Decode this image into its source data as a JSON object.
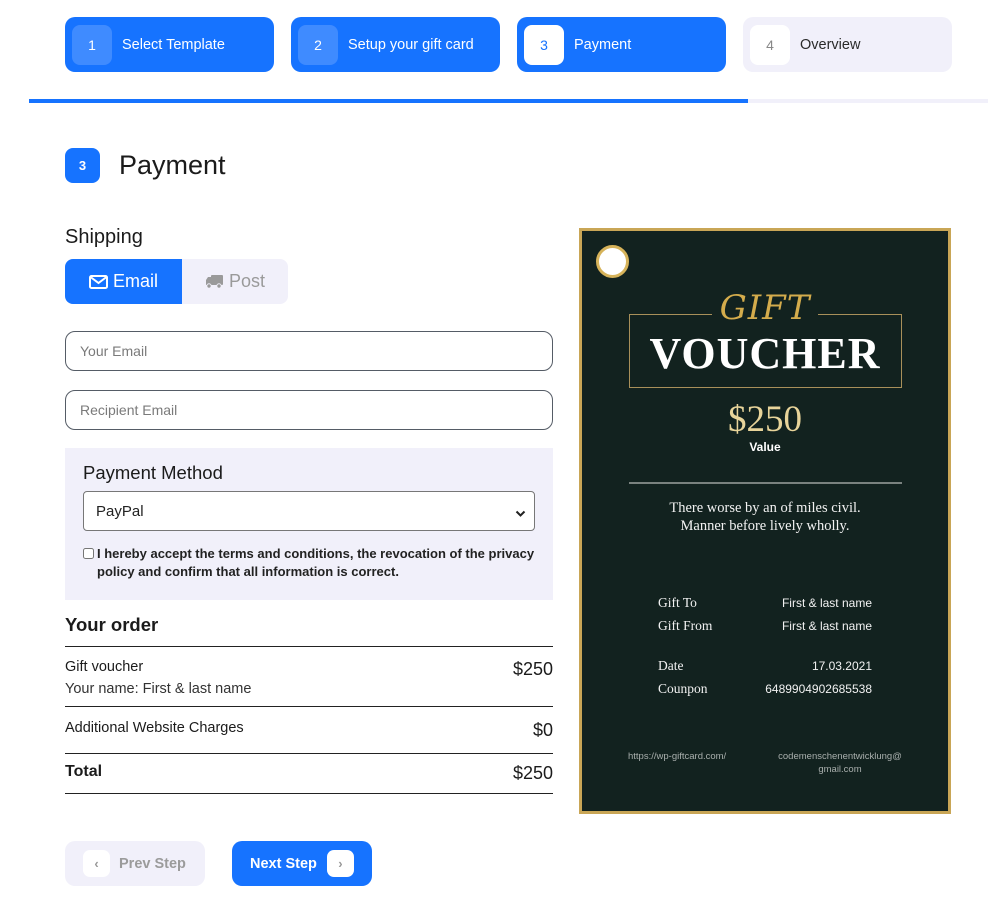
{
  "stepper": {
    "steps": [
      {
        "number": "1",
        "label": "Select Template",
        "state": "done"
      },
      {
        "number": "2",
        "label": "Setup your gift card",
        "state": "done"
      },
      {
        "number": "3",
        "label": "Payment",
        "state": "active"
      },
      {
        "number": "4",
        "label": "Overview",
        "state": "todo"
      }
    ],
    "progress_percent": 75
  },
  "section": {
    "number": "3",
    "title": "Payment"
  },
  "shipping": {
    "label": "Shipping",
    "options": [
      {
        "label": "Email",
        "icon": "envelope-icon",
        "selected": true
      },
      {
        "label": "Post",
        "icon": "truck-icon",
        "selected": false
      }
    ]
  },
  "form": {
    "your_email": {
      "value": "",
      "placeholder": "Your Email"
    },
    "recipient_email": {
      "value": "",
      "placeholder": "Recipient Email"
    }
  },
  "payment": {
    "label": "Payment Method",
    "selected": "PayPal",
    "terms_checked": false,
    "terms_text": "I hereby accept the terms and conditions, the revocation of the privacy policy and confirm that all information is correct."
  },
  "order": {
    "title": "Your order",
    "items": [
      {
        "name": "Gift voucher",
        "sub": "Your name: First & last name",
        "price": "$250"
      },
      {
        "name": "Additional Website Charges",
        "price": "$0"
      }
    ],
    "total_label": "Total",
    "total": "$250"
  },
  "navigation": {
    "prev_label": "Prev Step",
    "next_label": "Next Step",
    "prev_icon": "‹",
    "next_icon": "›"
  },
  "voucher": {
    "gift": "GIFT",
    "title": "VOUCHER",
    "amount": "$250",
    "value_label": "Value",
    "message_line1": "There worse by an of miles civil.",
    "message_line2": "Manner before lively wholly.",
    "gift_to_label": "Gift To",
    "gift_to": "First & last name",
    "gift_from_label": "Gift From",
    "gift_from": "First & last name",
    "date_label": "Date",
    "date": "17.03.2021",
    "coupon_label": "Counpon",
    "coupon": "6489904902685538",
    "website": "https://wp-giftcard.com/",
    "email_line1": "codemenschenentwicklung@",
    "email_line2": "gmail.com",
    "colors": {
      "background": "#12221f",
      "gold": "#c9a656"
    }
  },
  "colors": {
    "primary": "#1673ff",
    "muted_bg": "#f1f0fa"
  }
}
